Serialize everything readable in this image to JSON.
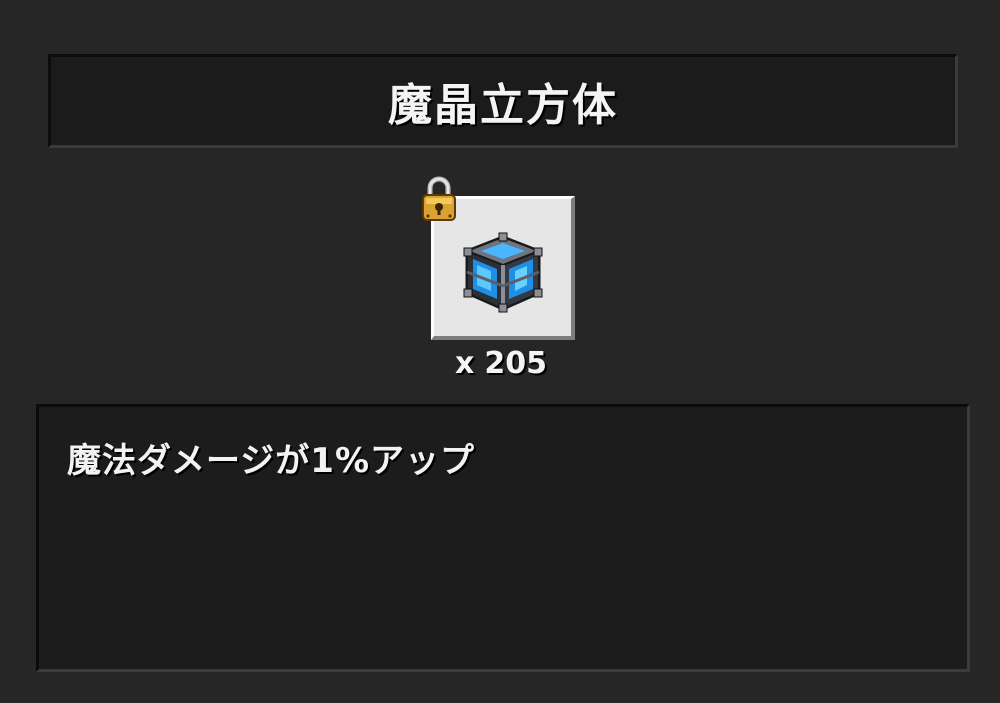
{
  "item": {
    "name": "魔晶立方体",
    "quantity_prefix": "x",
    "quantity": "205",
    "locked": true,
    "icon": "magic-crystal-cube-icon",
    "description": "魔法ダメージが1%アップ"
  },
  "colors": {
    "background": "#262626",
    "panel": "#1b1b1b",
    "slot": "#e6e6e6",
    "crystal": "#2fa8ff"
  }
}
